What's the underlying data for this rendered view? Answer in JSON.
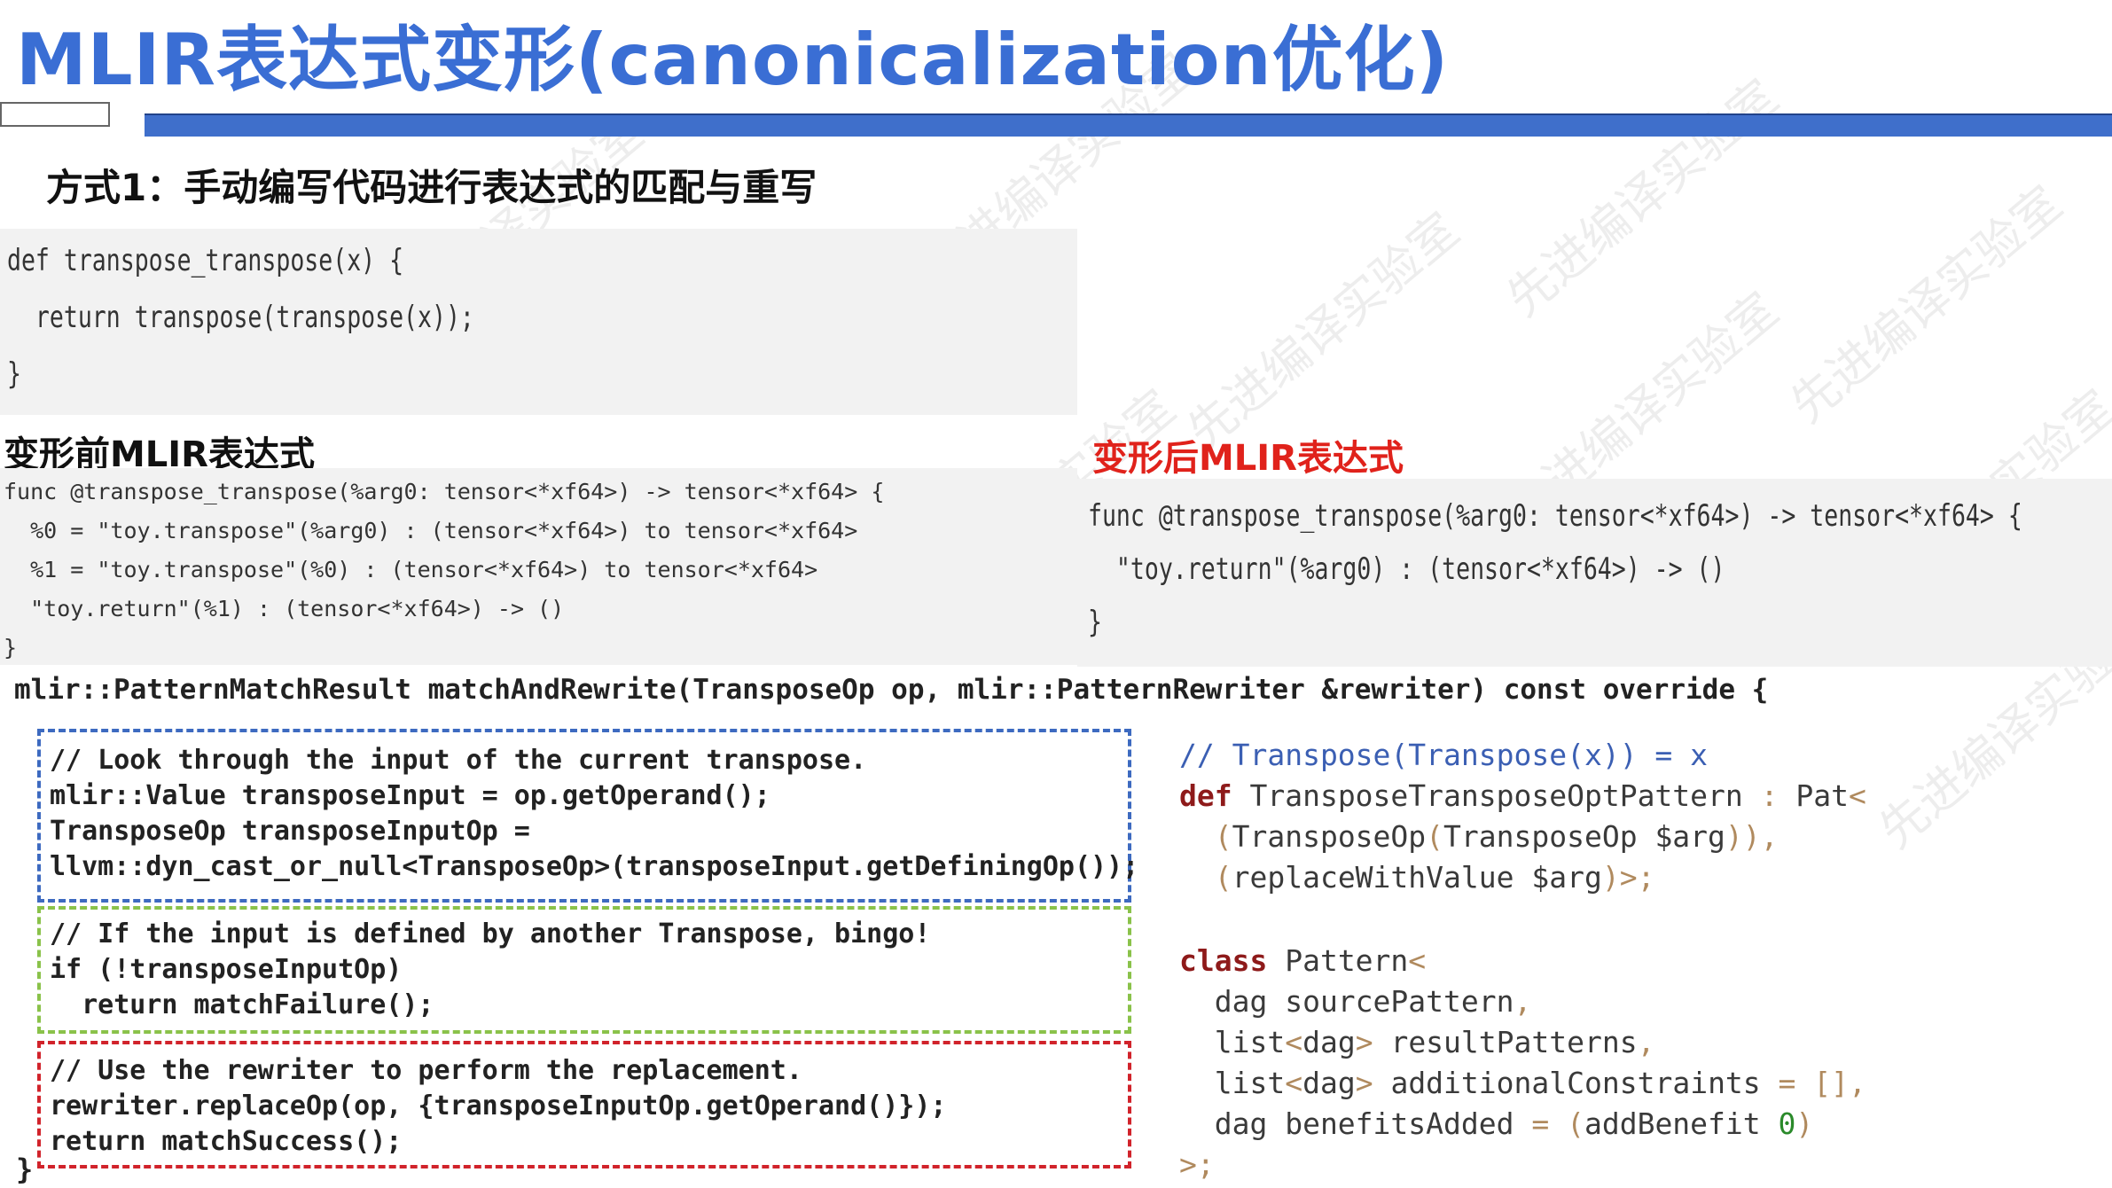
{
  "title": "MLIR表达式变形(canonicalization优化)",
  "method_heading": "方式1：手动编写代码进行表达式的匹配与重写",
  "python_code": [
    "def transpose_transpose(x) {",
    "  return transpose(transpose(x));",
    "}"
  ],
  "before_heading": "变形前MLIR表达式",
  "after_heading": "变形后MLIR表达式",
  "before_mlir": [
    "func @transpose_transpose(%arg0: tensor<*xf64>) -> tensor<*xf64> {",
    "  %0 = \"toy.transpose\"(%arg0) : (tensor<*xf64>) to tensor<*xf64>",
    "  %1 = \"toy.transpose\"(%0) : (tensor<*xf64>) to tensor<*xf64>",
    "  \"toy.return\"(%1) : (tensor<*xf64>) -> ()",
    "}"
  ],
  "after_mlir": [
    "func @transpose_transpose(%arg0: tensor<*xf64>) -> tensor<*xf64> {",
    "  \"toy.return\"(%arg0) : (tensor<*xf64>) -> ()",
    "}"
  ],
  "cpp_signature": "mlir::PatternMatchResult matchAndRewrite(TransposeOp op, mlir::PatternRewriter &rewriter) const override {",
  "cpp_blue": [
    "// Look through the input of the current transpose.",
    "mlir::Value transposeInput = op.getOperand();",
    "TransposeOp transposeInputOp =",
    "llvm::dyn_cast_or_null<TransposeOp>(transposeInput.getDefiningOp());"
  ],
  "cpp_green": [
    "// If the input is defined by another Transpose, bingo!",
    "if (!transposeInputOp)",
    "  return matchFailure();"
  ],
  "cpp_red": [
    "// Use the rewriter to perform the replacement.",
    "rewriter.replaceOp(op, {transposeInputOp.getOperand()});",
    "return matchSuccess();"
  ],
  "cpp_closing": "}",
  "tablegen": {
    "comment": "// Transpose(Transpose(x)) = x",
    "def_kw": "def",
    "def_name": " TransposeTransposeOptPattern ",
    "def_colon": ":",
    "def_pat": " Pat",
    "def_lt": "<",
    "line3_a": "  (",
    "line3_b": "TransposeOp",
    "line3_c": "(",
    "line3_d": "TransposeOp $arg",
    "line3_e": ")),",
    "line4_a": "  (",
    "line4_b": "replaceWithValue $arg",
    "line4_c": ")>;",
    "class_kw": "class",
    "class_name": " Pattern",
    "class_lt": "<",
    "f1_type": "  dag sourcePattern",
    "f1_p": ",",
    "f2_a": "  list",
    "f2_b": "<",
    "f2_c": "dag",
    "f2_d": ">",
    "f2_e": " resultPatterns",
    "f2_f": ",",
    "f3_a": "  list",
    "f3_b": "<",
    "f3_c": "dag",
    "f3_d": ">",
    "f3_e": " additionalConstraints ",
    "f3_f": "= [],",
    "f4_a": "  dag benefitsAdded ",
    "f4_b": "= (",
    "f4_c": "addBenefit ",
    "f4_d": "0",
    "f4_e": ")",
    "end": ">;"
  },
  "watermark_text": "先进编译实验室",
  "colors": {
    "title": "#3a6ed4",
    "title_bar": "#3f6fcb",
    "after_heading": "#e0221b",
    "box_blue": "#3d6ac0",
    "box_green": "#8ac24a",
    "box_red": "#d1232b"
  }
}
